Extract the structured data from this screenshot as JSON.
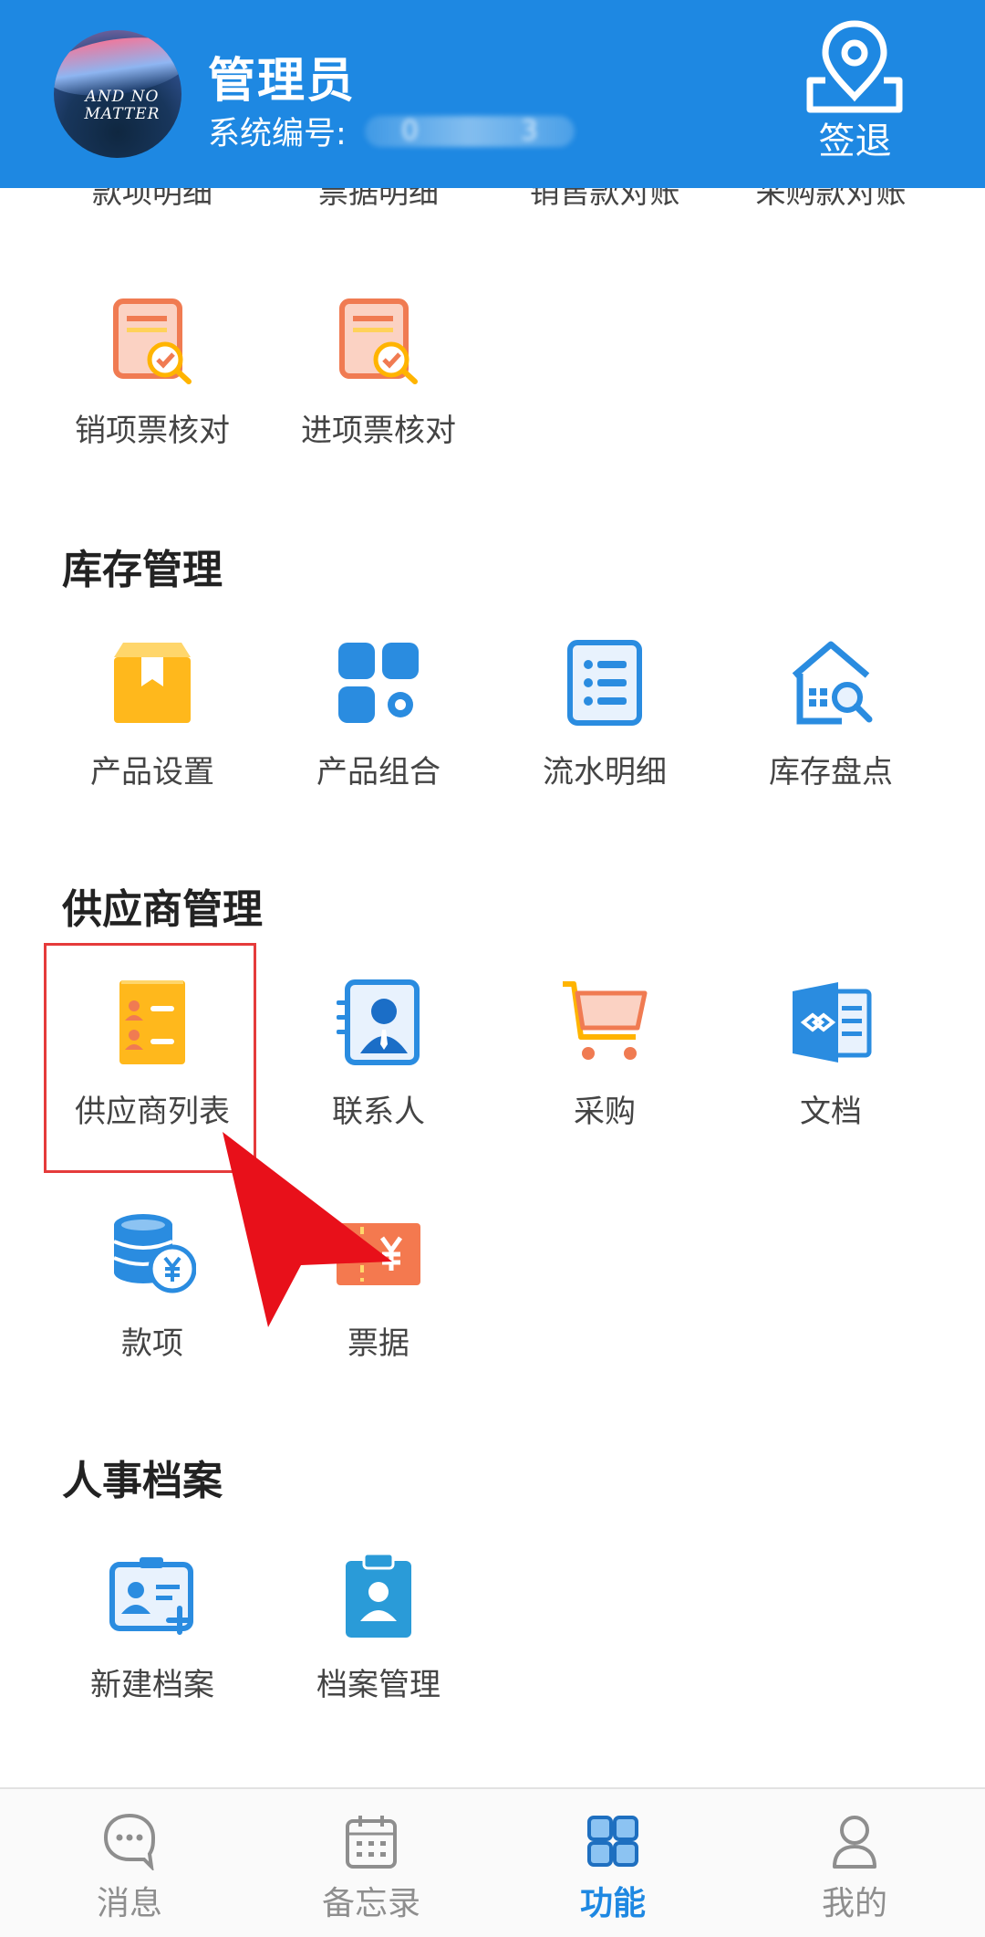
{
  "header": {
    "admin_name": "管理员",
    "system_no_label": "系统编号:",
    "system_no_first": "0",
    "system_no_last": "3",
    "avatar_caption": "AND NO MATTER",
    "signout_label": "签退"
  },
  "top_partial_row": [
    "款项明细",
    "票据明细",
    "销售款对账",
    "采购款对账"
  ],
  "finance_items": [
    {
      "label": "销项票核对",
      "icon": "invoice-check-icon"
    },
    {
      "label": "进项票核对",
      "icon": "invoice-check-icon"
    }
  ],
  "sections": {
    "inventory": {
      "title": "库存管理",
      "items": [
        {
          "label": "产品设置",
          "icon": "product-box-icon"
        },
        {
          "label": "产品组合",
          "icon": "product-combo-icon"
        },
        {
          "label": "流水明细",
          "icon": "list-document-icon"
        },
        {
          "label": "库存盘点",
          "icon": "warehouse-search-icon"
        }
      ]
    },
    "supplier": {
      "title": "供应商管理",
      "items": [
        {
          "label": "供应商列表",
          "icon": "supplier-list-icon"
        },
        {
          "label": "联系人",
          "icon": "contact-card-icon"
        },
        {
          "label": "采购",
          "icon": "shopping-cart-icon"
        },
        {
          "label": "文档",
          "icon": "document-icon"
        },
        {
          "label": "款项",
          "icon": "coins-yuan-icon"
        },
        {
          "label": "票据",
          "icon": "ticket-yuan-icon"
        }
      ]
    },
    "hr": {
      "title": "人事档案",
      "items": [
        {
          "label": "新建档案",
          "icon": "new-profile-icon"
        },
        {
          "label": "档案管理",
          "icon": "profile-clipboard-icon"
        }
      ]
    }
  },
  "tabs": [
    {
      "label": "消息",
      "icon": "message-icon",
      "active": false
    },
    {
      "label": "备忘录",
      "icon": "calendar-icon",
      "active": false
    },
    {
      "label": "功能",
      "icon": "grid-icon",
      "active": true
    },
    {
      "label": "我的",
      "icon": "person-icon",
      "active": false
    }
  ],
  "colors": {
    "header_bg": "#1e88e2",
    "accent": "#1e88e2",
    "highlight_border": "#e53b3b",
    "arrow": "#e8101a"
  }
}
